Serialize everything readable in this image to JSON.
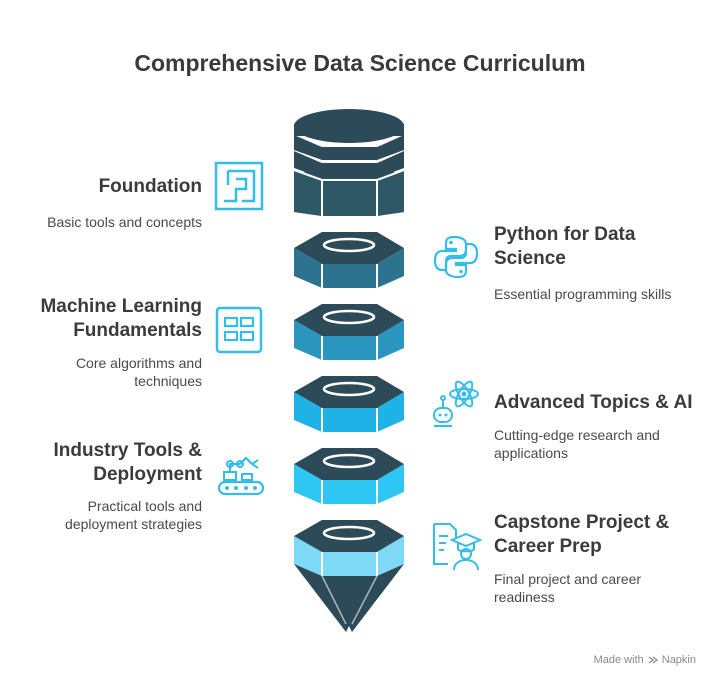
{
  "title": "Comprehensive Data Science Curriculum",
  "colors": {
    "cap": "#2d4a58",
    "ring": "#ffffff",
    "block1": "#2e5866",
    "block2": "#2d7390",
    "block3": "#2a95be",
    "block4": "#1eb2e6",
    "block5": "#2ec6f2",
    "block6": "#7dd9f6",
    "icon": "#33bde8",
    "tip": "#2d4a58"
  },
  "stages": [
    {
      "title": "Foundation",
      "desc": "Basic tools and concepts",
      "icon": "square-frame-icon"
    },
    {
      "title": "Python for Data Science",
      "desc": "Essential programming skills",
      "icon": "python-icon"
    },
    {
      "title": "Machine Learning Fundamentals",
      "desc": "Core algorithms and techniques",
      "icon": "grid-blocks-icon"
    },
    {
      "title": "Advanced Topics & AI",
      "desc": "Cutting-edge research and applications",
      "icon": "atom-robot-icon"
    },
    {
      "title": "Industry Tools & Deployment",
      "desc": "Practical tools and deployment strategies",
      "icon": "conveyor-robot-arm-icon"
    },
    {
      "title": "Capstone Project & Career Prep",
      "desc": "Final project and career readiness",
      "icon": "graduate-document-icon"
    }
  ],
  "footer": {
    "text": "Made with",
    "brand": "Napkin"
  }
}
